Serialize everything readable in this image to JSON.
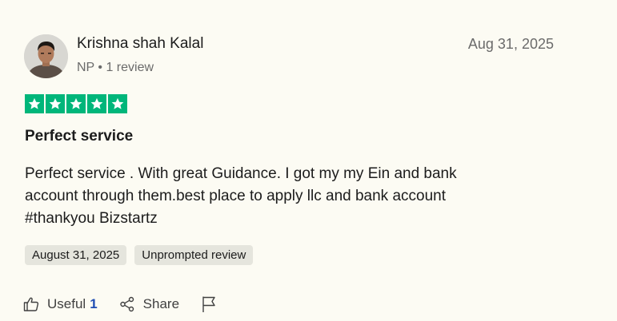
{
  "reviewer": {
    "name": "Krishna shah Kalal",
    "country": "NP",
    "separator": "•",
    "review_count": "1 review"
  },
  "review": {
    "date": "Aug 31, 2025",
    "rating": 5,
    "title": "Perfect service",
    "body_lines": [
      "Perfect service . With great Guidance. I got my my Ein and bank",
      "account through them.best place to apply llc and bank account",
      "#thankyou Bizstartz"
    ],
    "tags": {
      "experience_date": "August 31, 2025",
      "review_type": "Unprompted review"
    }
  },
  "actions": {
    "useful_label": "Useful",
    "useful_count": "1",
    "share_label": "Share"
  },
  "colors": {
    "star": "#00b67a",
    "background": "#fcfbf3",
    "tag_bg": "#e5e5dd",
    "count_accent": "#1f4db3"
  },
  "icons": {
    "useful": "thumbs-up-icon",
    "share": "share-icon",
    "report": "flag-icon"
  }
}
